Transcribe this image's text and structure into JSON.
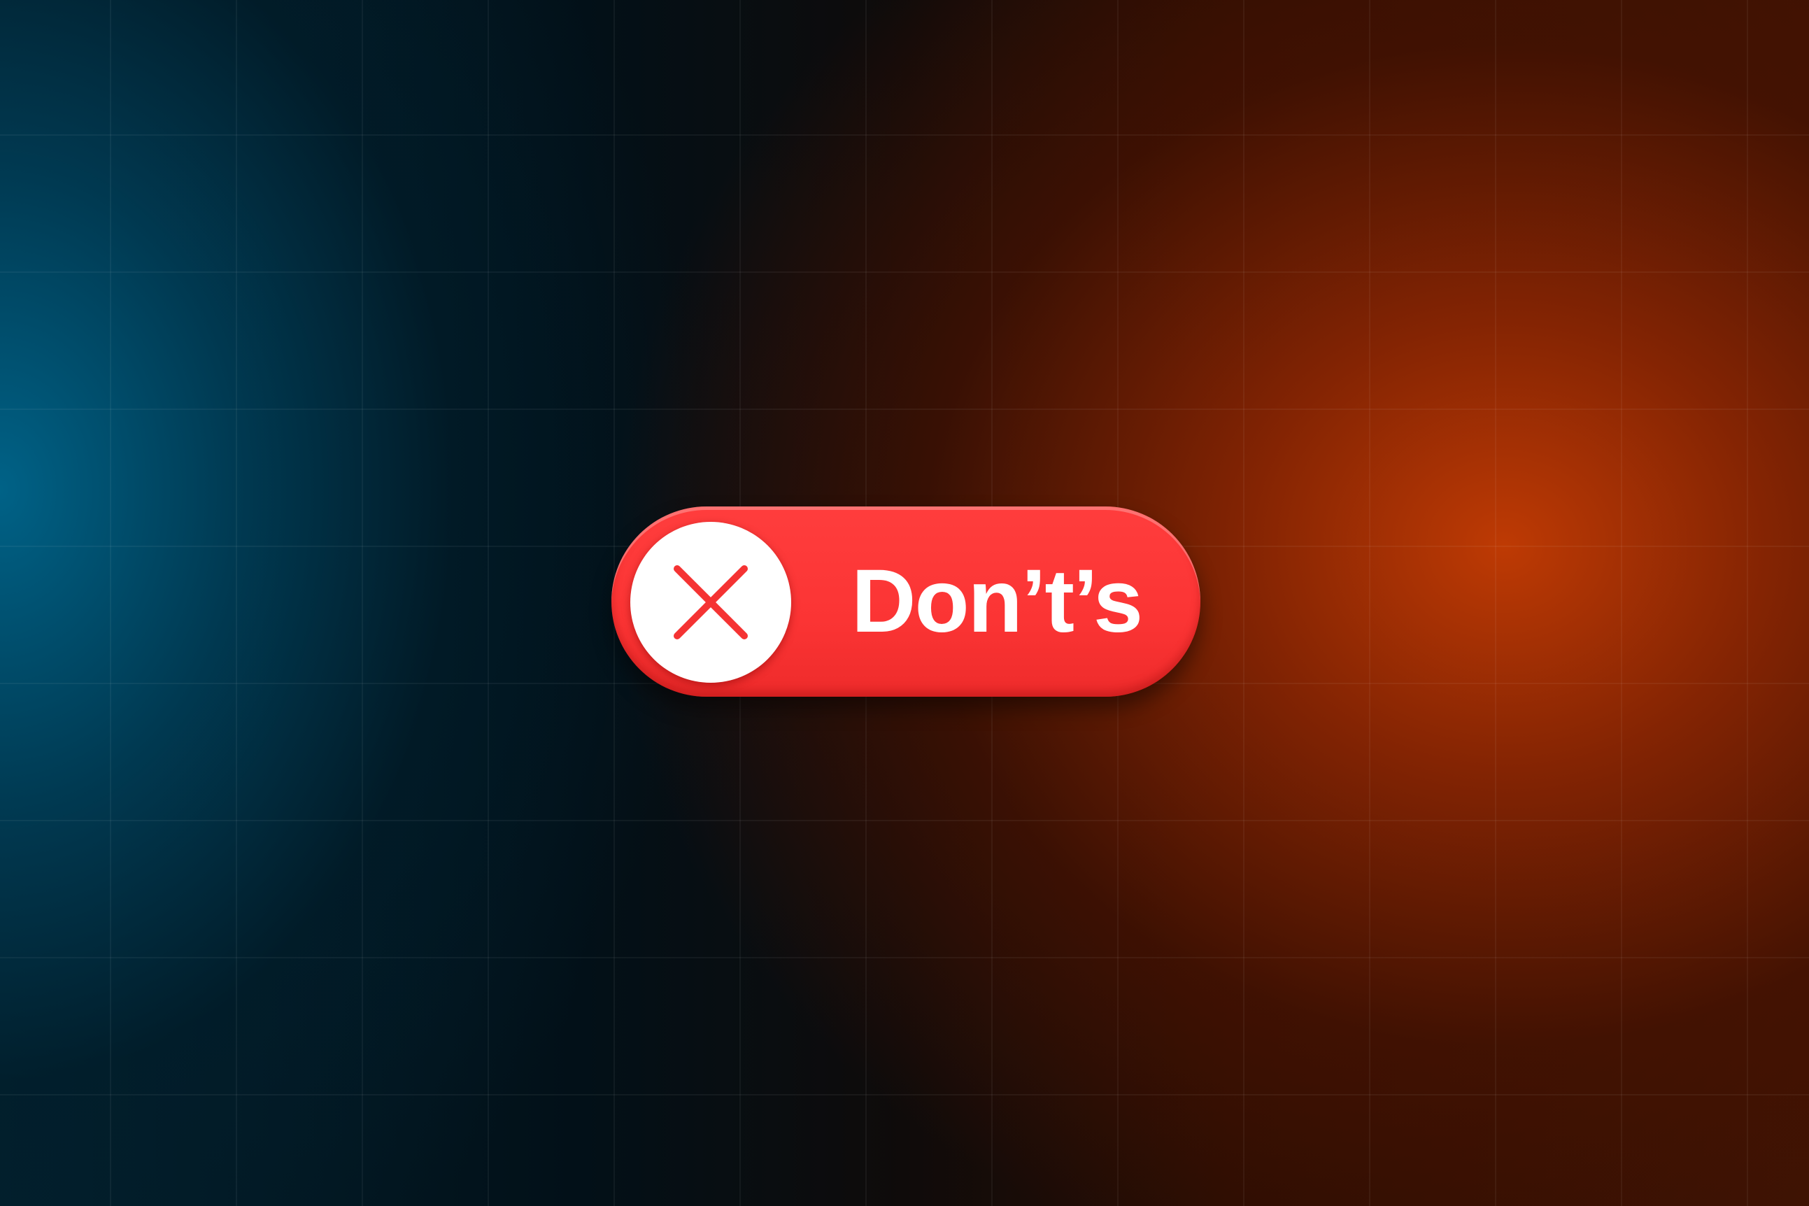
{
  "toggle": {
    "label": "Don’t’s",
    "state": "off",
    "icon": "close-icon",
    "color": "#fb3434"
  },
  "colors": {
    "accent_red": "#fb3434",
    "glow_orange": "#be3a04",
    "glow_blue": "#006287"
  }
}
